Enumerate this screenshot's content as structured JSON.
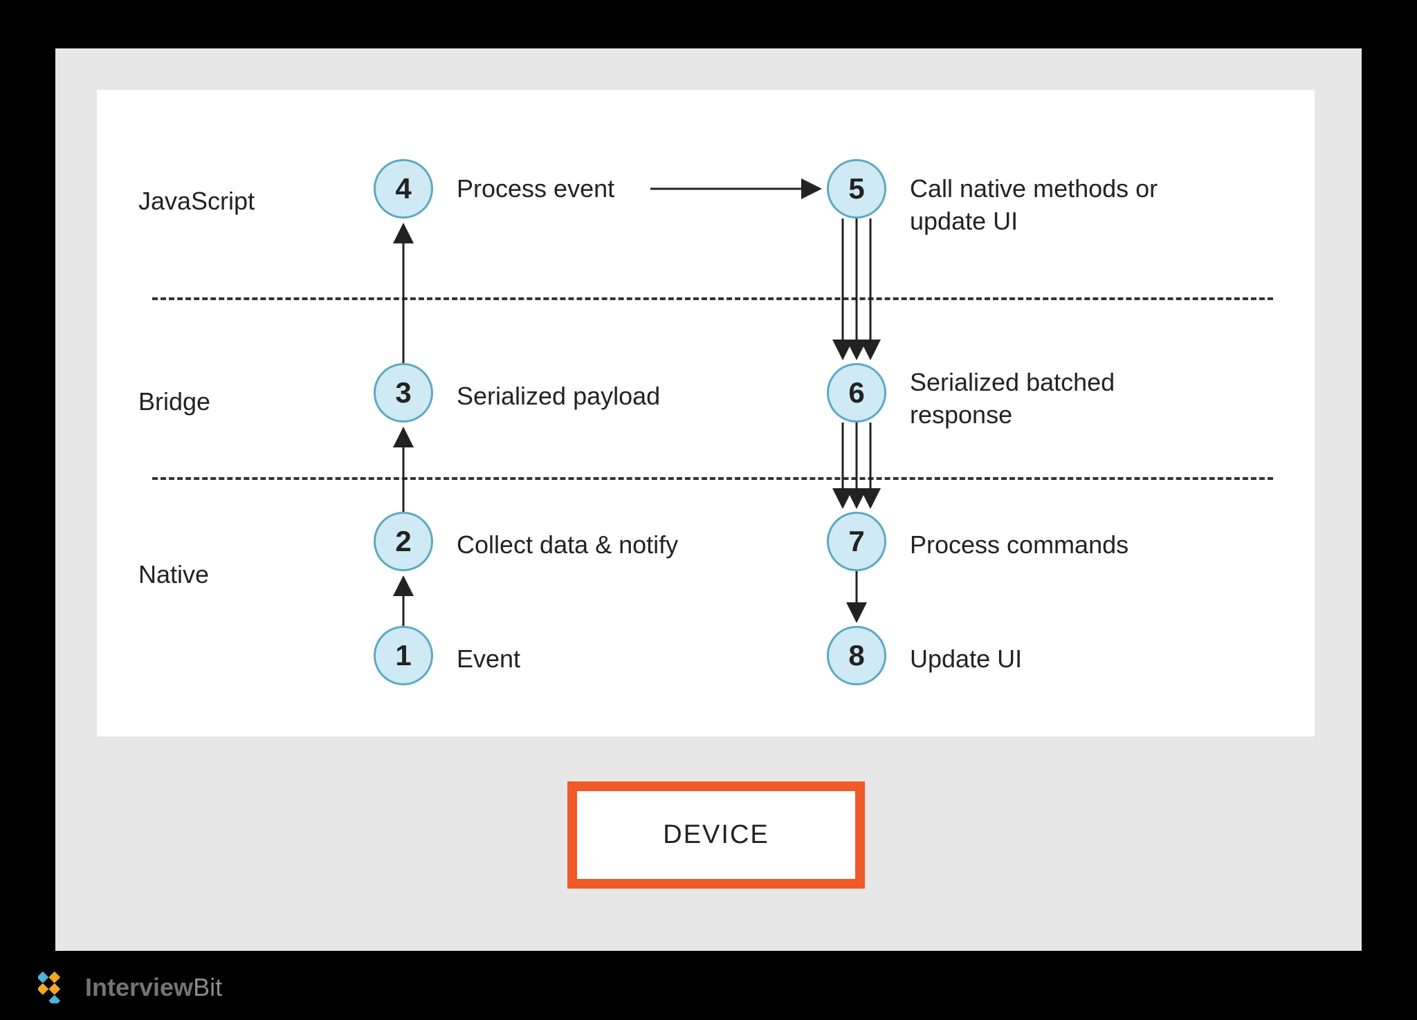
{
  "layers": {
    "javascript": "JavaScript",
    "bridge": "Bridge",
    "native": "Native"
  },
  "nodes": {
    "n1": {
      "num": "1",
      "label": "Event"
    },
    "n2": {
      "num": "2",
      "label": "Collect data & notify"
    },
    "n3": {
      "num": "3",
      "label": "Serialized payload"
    },
    "n4": {
      "num": "4",
      "label": "Process event"
    },
    "n5": {
      "num": "5",
      "label": "Call native methods or update UI"
    },
    "n6": {
      "num": "6",
      "label": "Serialized batched response"
    },
    "n7": {
      "num": "7",
      "label": "Process commands"
    },
    "n8": {
      "num": "8",
      "label": "Update UI"
    }
  },
  "device_label": "DEVICE",
  "brand": {
    "part1": "Interview",
    "part2": "Bit"
  },
  "colors": {
    "node_fill": "#cfeaf4",
    "node_stroke": "#5ba9c2",
    "accent_orange": "#f05a28",
    "panel_bg": "#e7e7e7"
  }
}
